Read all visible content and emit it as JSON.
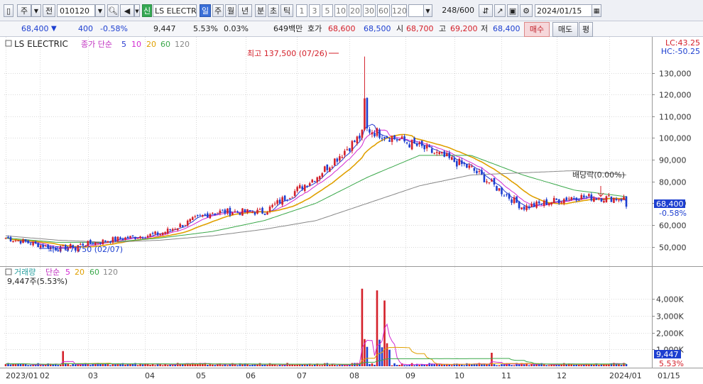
{
  "toolbar": {
    "type_label": "주",
    "market_label": "전",
    "code": "010120",
    "name_badge": "신",
    "name": "LS ELECTRI",
    "periods": [
      "일",
      "주",
      "월",
      "년",
      "분",
      "초",
      "틱"
    ],
    "active_period": "일",
    "minutes": [
      "1",
      "3",
      "5",
      "10",
      "20",
      "30",
      "60",
      "120"
    ],
    "count": "248",
    "count_total": "/600",
    "date": "2024/01/15"
  },
  "quote": {
    "price": "68,400",
    "change": "400",
    "change_pct": "-0.58%",
    "volume": "9,447",
    "volume_ratio": "5.53%",
    "turnover": "0.03%",
    "amount": "649백만",
    "ask_label": "호가",
    "ask": "68,600",
    "bid": "68,500",
    "open_label": "시",
    "open": "68,700",
    "high_label": "고",
    "high": "69,200",
    "low_label": "저",
    "low": "68,400",
    "buy_label": "매수",
    "sell_label": "매도",
    "eval_label": "평"
  },
  "price_panel": {
    "title": "LS ELECTRIC",
    "ma_label": "종가 단순",
    "ma_periods": [
      "5",
      "10",
      "20",
      "60",
      "120"
    ],
    "lc": "LC:43.25",
    "hc": "HC:-50.25",
    "last_price_label": "68,400",
    "last_change_label": "-0.58%",
    "high_annotation": "최고 137,500 (07/26)",
    "low_annotation": "최저 47,750 (02/07)",
    "dividend_annotation": "배당락(0.00%)"
  },
  "volume_panel": {
    "title": "거래량",
    "ma_label": "단순",
    "ma_periods": [
      "5",
      "20",
      "60",
      "120"
    ],
    "current": "9,447주(5.53%)",
    "last_volume_label": "9,447",
    "last_ratio_label": "5.53%"
  },
  "colors": {
    "up": "#d4202a",
    "down": "#1d3fd0",
    "ma5": "#2a3cd0",
    "ma10": "#d22ad2",
    "ma20": "#e0a000",
    "ma60": "#3aa84a",
    "ma120": "#888888"
  },
  "chart_data": {
    "type": "line",
    "title": "LS ELECTRIC",
    "series": [
      {
        "name": "종가",
        "x": [
          "2023/01",
          "02",
          "03",
          "04",
          "05",
          "06",
          "07",
          "08",
          "09",
          "10",
          "11",
          "12",
          "2024/01"
        ],
        "values": [
          54000,
          49000,
          53000,
          56000,
          66000,
          66000,
          82000,
          104000,
          96000,
          86000,
          68000,
          73000,
          72000
        ]
      },
      {
        "name": "60",
        "values": [
          54000,
          52000,
          52000,
          54000,
          57000,
          62000,
          70000,
          82000,
          92000,
          92000,
          83000,
          76000,
          73000
        ]
      },
      {
        "name": "120",
        "values": [
          55000,
          53000,
          52000,
          53000,
          55000,
          58000,
          62000,
          70000,
          78000,
          83000,
          84000,
          85000,
          83000
        ]
      }
    ],
    "x_ticks": [
      "2023/01",
      "02",
      "03",
      "04",
      "05",
      "06",
      "07",
      "08",
      "09",
      "10",
      "11",
      "12",
      "2024/01",
      "01/15"
    ],
    "y_ticks": [
      50000,
      60000,
      70000,
      80000,
      90000,
      100000,
      110000,
      120000,
      130000
    ],
    "ylim": [
      42000,
      140000
    ],
    "high": {
      "value": 137500,
      "date": "07/26"
    },
    "low": {
      "value": 47750,
      "date": "02/07"
    },
    "last": 68400,
    "volume": {
      "y_ticks": [
        1000,
        2000,
        3000,
        4000
      ],
      "y_tick_labels": [
        "1,000K",
        "2,000K",
        "3,000K",
        "4,000K"
      ],
      "ylim": [
        0,
        4800
      ],
      "unit": "K",
      "peaks": [
        {
          "month": "07",
          "value": 4600
        },
        {
          "month": "08",
          "value": 4500
        },
        {
          "month": "08",
          "value": 3900
        },
        {
          "month": "02",
          "value": 900
        },
        {
          "month": "11",
          "value": 800
        }
      ],
      "last": 9.447
    }
  }
}
